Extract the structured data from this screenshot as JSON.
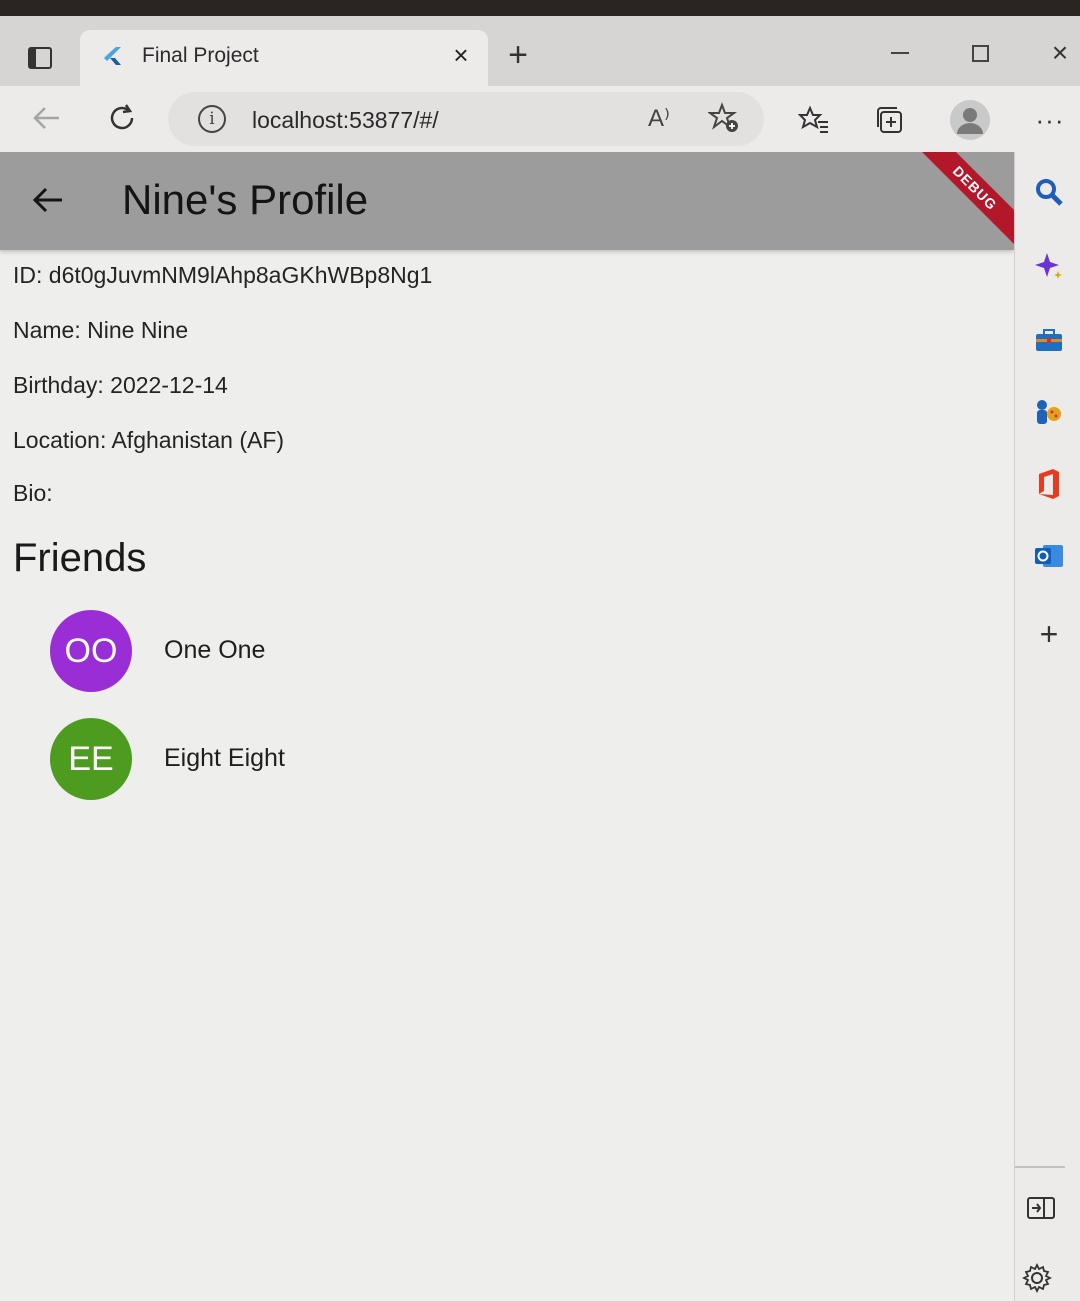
{
  "browser": {
    "tab_title": "Final Project",
    "url": "localhost:53877/#/",
    "read_aloud_glyph": "A⁾",
    "more_glyph": "···"
  },
  "appbar": {
    "title": "Nine's Profile",
    "debug_label": "DEBUG"
  },
  "profile": {
    "id": "ID: d6t0gJuvmNM9lAhp8aGKhWBp8Ng1",
    "name": "Name: Nine Nine",
    "birthday": "Birthday: 2022-12-14",
    "location": "Location: Afghanistan (AF)",
    "bio": "Bio:"
  },
  "friends": {
    "heading": "Friends",
    "items": [
      {
        "initials": "OO",
        "name": "One One",
        "color": "#9a2ed6"
      },
      {
        "initials": "EE",
        "name": "Eight Eight",
        "color": "#4e9c1f"
      }
    ]
  },
  "sidebar": {
    "icons": [
      "search-icon",
      "copilot-icon",
      "tools-icon",
      "games-icon",
      "office-icon",
      "outlook-icon",
      "add-icon",
      "hide-sidebar-icon",
      "settings-icon"
    ]
  }
}
